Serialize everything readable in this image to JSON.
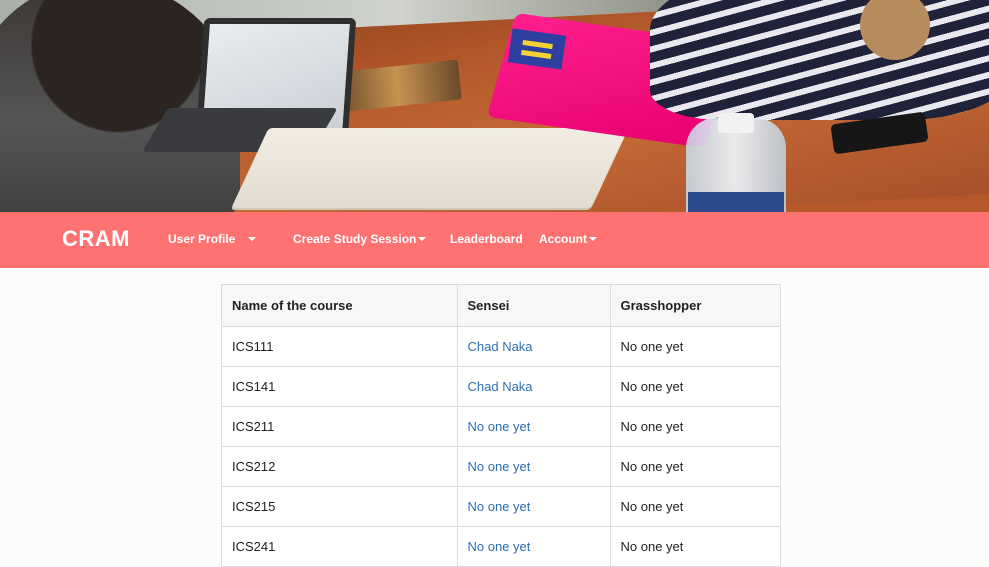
{
  "navbar": {
    "brand": "CRAM",
    "items": [
      {
        "label": "User Profile",
        "dropdown": true
      },
      {
        "label": "Create Study Session",
        "dropdown": true
      },
      {
        "label": "Leaderboard",
        "dropdown": false
      },
      {
        "label": "Account",
        "dropdown": true
      }
    ],
    "background_color": "#ff7272"
  },
  "table": {
    "headers": [
      "Name of the course",
      "Sensei",
      "Grasshopper"
    ],
    "rows": [
      {
        "course": "ICS111",
        "sensei": "Chad Naka",
        "grasshopper": "No one yet"
      },
      {
        "course": "ICS141",
        "sensei": "Chad Naka",
        "grasshopper": "No one yet"
      },
      {
        "course": "ICS211",
        "sensei": "No one yet",
        "grasshopper": "No one yet"
      },
      {
        "course": "ICS212",
        "sensei": "No one yet",
        "grasshopper": "No one yet"
      },
      {
        "course": "ICS215",
        "sensei": "No one yet",
        "grasshopper": "No one yet"
      },
      {
        "course": "ICS241",
        "sensei": "No one yet",
        "grasshopper": "No one yet"
      }
    ],
    "link_color": "#2f6fb3"
  }
}
